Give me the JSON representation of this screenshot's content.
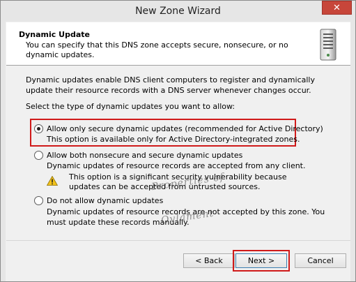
{
  "window": {
    "title": "New Zone Wizard",
    "close_label": "✕"
  },
  "header": {
    "title": "Dynamic Update",
    "description": "You can specify that this DNS zone accepts secure, nonsecure, or no dynamic updates.",
    "icon": "server-icon"
  },
  "content": {
    "intro": "Dynamic updates enable DNS client computers to register and dynamically update their resource records with a DNS server whenever changes occur.",
    "prompt": "Select the type of dynamic updates you want to allow:",
    "options": [
      {
        "label": "Allow only secure dynamic updates (recommended for Active Directory)",
        "description": "This option is available only for Active Directory-integrated zones.",
        "selected": true
      },
      {
        "label": "Allow both nonsecure and secure dynamic updates",
        "description": "Dynamic updates of resource records are accepted from any client.",
        "selected": false
      },
      {
        "label": "Do not allow dynamic updates",
        "description": "Dynamic updates of resource records are not accepted by this zone. You must update these records manually.",
        "selected": false
      }
    ],
    "warning": {
      "icon": "warning-icon",
      "text": "This option is a significant security vulnerability because updates can be accepted from untrusted sources."
    },
    "watermark_line1": "Properties of",
    "watermark_line2": "Ovlament"
  },
  "buttons": {
    "back": "< Back",
    "next": "Next >",
    "cancel": "Cancel"
  },
  "colors": {
    "highlight": "#d01a1a",
    "window_bg": "#f0f0f0",
    "close_bg": "#c7463a"
  }
}
